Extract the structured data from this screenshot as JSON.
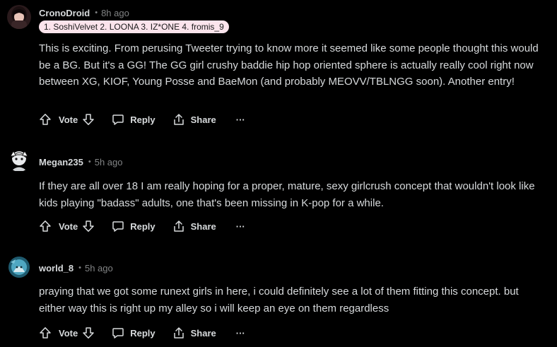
{
  "comments": [
    {
      "username": "CronoDroid",
      "time": "8h ago",
      "flair": "1. SoshiVelvet 2. LOONA 3. IZ*ONE 4. fromis_9",
      "body": "This is exciting. From perusing Tweeter trying to know more it seemed like some people thought this would be a BG. But it's a GG! The GG girl crushy baddie hip hop oriented sphere is actually really cool right now between XG, KIOF, Young Posse and BaeMon (and probably MEOVV/TBLNGG soon). Another entry!"
    },
    {
      "username": "Megan235",
      "time": "5h ago",
      "body": "If they are all over 18 I am really hoping for a proper, mature, sexy girlcrush concept that wouldn't look like kids playing \"badass\" adults, one that's been missing in K-pop for a while."
    },
    {
      "username": "world_8",
      "time": "5h ago",
      "body": "praying that we got some runext girls in here, i could definitely see a lot of them fitting this concept. but either way this is right up my alley so i will keep an eye on them regardless"
    }
  ],
  "actions": {
    "vote": "Vote",
    "reply": "Reply",
    "share": "Share",
    "more": "···"
  },
  "colors": {
    "background": "#000000",
    "text": "#d7dadc",
    "muted": "#818384",
    "flair_bg": "#fbe4ec"
  }
}
